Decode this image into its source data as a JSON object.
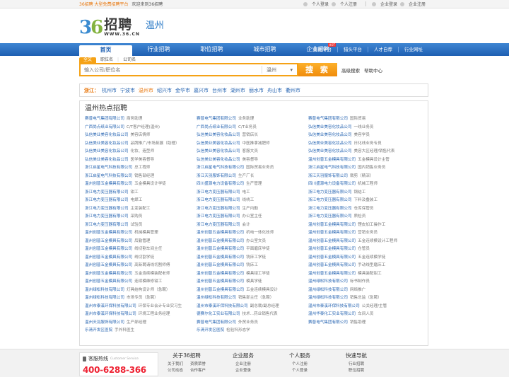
{
  "topbar": {
    "brand": "36招聘 大型免费招聘平台",
    "welcome": "欢迎来到36招聘",
    "person_login": "个人登录",
    "person_register": "个人注册",
    "company_login": "企业登录",
    "company_register": "企业注册"
  },
  "logo": {
    "num_a": "3",
    "num_b": "6",
    "cn": "招聘",
    "url": "WWW.36.CN",
    "city": "温州"
  },
  "nav": {
    "items": [
      "首页",
      "行业招聘",
      "职位招聘",
      "城市招聘",
      "企业招聘"
    ],
    "active": 0,
    "right": [
      "简聘平台",
      "猎头平台",
      "人才自荐",
      "行业网址"
    ],
    "hot_badge": "HOT"
  },
  "search": {
    "tabs": [
      "全文",
      "职位名",
      "公司名"
    ],
    "active_tab": 0,
    "placeholder": "输入公司/职位名",
    "city": "温州",
    "city_arrow": "▾",
    "button": "搜 索",
    "advanced": "高级搜索",
    "help": "帮助中心"
  },
  "cities": {
    "label": "浙江：",
    "items": [
      "杭州市",
      "宁波市",
      "温州市",
      "绍兴市",
      "金华市",
      "嘉兴市",
      "台州市",
      "湖州市",
      "丽水市",
      "舟山市",
      "衢州市"
    ],
    "active": 2
  },
  "hot": {
    "title": "温州热点招聘",
    "rows": [
      [
        [
          "赛普电气集团有限公司",
          "商务助理"
        ],
        [
          "赛普电气集团有限公司",
          "业务助理"
        ],
        [
          "赛普电气集团有限公司",
          "国际贸易"
        ]
      ],
      [
        [
          "广西尚点纸业有限公司",
          "C/T客户经理(温州)"
        ],
        [
          "广西尚点纸业有限公司",
          "C/T业务员"
        ],
        [
          "弘信美业美容化妆品公司",
          "一线业务员"
        ]
      ],
      [
        [
          "弘信美业美容化妆品公司",
          "美容店情师"
        ],
        [
          "弘信美业美容化妆品公司",
          "营销店长"
        ],
        [
          "弘信美业美容化妆品公司",
          "美容学员"
        ]
      ],
      [
        [
          "弘信美业美容化妆品公司",
          "品牌推广/市场拓展（助理）"
        ],
        [
          "弘信美业美容化妆品公司",
          "中医推拿减肥师"
        ],
        [
          "弘信美业美容化妆品公司",
          "日化线业务专员"
        ]
      ],
      [
        [
          "弘信美业美容化妆品公司",
          "化妆、造型师"
        ],
        [
          "弘信美业美容化妆品公司",
          "客服文员"
        ],
        [
          "弘信美业美容化妆品公司",
          "美容大区经理/销售代表"
        ]
      ],
      [
        [
          "弘信美业美容化妆品公司",
          "医学美容督导"
        ],
        [
          "弘信美业美容化妆品公司",
          "美容督导"
        ],
        [
          "温州创普五金模具有限公司",
          "五金模具设计主管"
        ]
      ],
      [
        [
          "浙江启星电气科技有限公司",
          "总工程师"
        ],
        [
          "浙江启星电气科技有限公司",
          "国际贸易业务员"
        ],
        [
          "浙江启星电气科技有限公司",
          "国内销售业务员"
        ]
      ],
      [
        [
          "浙江启星电气科技有限公司",
          "销售部经理"
        ],
        [
          "浙江天羽服饰有限公司",
          "生产厂长"
        ],
        [
          "浙江天羽服饰有限公司",
          "裁剪（精深）"
        ]
      ],
      [
        [
          "温州创普五金模具有限公司",
          "五金模具设计学徒"
        ],
        [
          "四川盛源电力设备有限公司",
          "生产管理"
        ],
        [
          "四川盛源电力设备有限公司",
          "机械工程师"
        ]
      ],
      [
        [
          "浙江电力变压器有限公司",
          "钳工"
        ],
        [
          "浙江电力变压器有限公司",
          "电工"
        ],
        [
          "浙江电力变压器有限公司",
          "钢结工"
        ]
      ],
      [
        [
          "浙江电力变压器有限公司",
          "电焊工"
        ],
        [
          "浙江电力变压器有限公司",
          "线绕工"
        ],
        [
          "浙江电力变压器有限公司",
          "下料及叠装工"
        ]
      ],
      [
        [
          "浙江电力变压器有限公司",
          "主变装配工"
        ],
        [
          "浙江电力变压器有限公司",
          "生产内勤"
        ],
        [
          "浙江电力变压器有限公司",
          "仓库保管员"
        ]
      ],
      [
        [
          "浙江电力变压器有限公司",
          "采购员"
        ],
        [
          "浙江电力变压器有限公司",
          "办公室主任"
        ],
        [
          "浙江电力变压器有限公司",
          "质检员"
        ]
      ],
      [
        [
          "浙江电力变压器有限公司",
          "试验员"
        ],
        [
          "浙江电力变压器有限公司",
          "会计"
        ],
        [
          "温州创普五金模具有限公司",
          "锂皮加工操作工"
        ]
      ],
      [
        [
          "温州创普五金模具有限公司",
          "机械模具管理"
        ],
        [
          "温州创普五金模具有限公司",
          "机电一体化技师"
        ],
        [
          "温州创普五金模具有限公司",
          "营销业务员"
        ]
      ],
      [
        [
          "温州创普五金模具有限公司",
          "后勤管理"
        ],
        [
          "温州创普五金模具有限公司",
          "办公室文员"
        ],
        [
          "温州创普五金模具有限公司",
          "五金连续模设计工程师"
        ]
      ],
      [
        [
          "温州创普五金模具有限公司",
          "线切割车间主任"
        ],
        [
          "温州创普五金模具有限公司",
          "平面磨床学徒"
        ],
        [
          "温州创普五金模具有限公司",
          "仓管员"
        ]
      ],
      [
        [
          "温州创普五金模具有限公司",
          "线切割学徒"
        ],
        [
          "温州创普五金模具有限公司",
          "铣床工学徒"
        ],
        [
          "温州创普五金模具有限公司",
          "五金连续模学徒"
        ]
      ],
      [
        [
          "温州创普五金模具有限公司",
          "高新聘请线切割师傅"
        ],
        [
          "温州创普五金模具有限公司",
          "铣床工"
        ],
        [
          "温州创普五金模具有限公司",
          "手动线型磨床工"
        ]
      ],
      [
        [
          "温州创普五金模具有限公司",
          "五金连续模装配老师"
        ],
        [
          "温州创普五金模具有限公司",
          "模具钳工学徒"
        ],
        [
          "温州创普五金模具有限公司",
          "模具装配钳工"
        ]
      ],
      [
        [
          "温州创普五金模具有限公司",
          "连续模维修钳工"
        ],
        [
          "温州创普五金模具有限公司",
          "模具学徒"
        ],
        [
          "温州绿松科技有限公司",
          "标书制作员"
        ]
      ],
      [
        [
          "温州绿松科技有限公司",
          "灯具结构设计师（急聘）"
        ],
        [
          "温州创普五金模具有限公司",
          "五金连续模具设计"
        ],
        [
          "温州绿松科技有限公司",
          "网络推广"
        ]
      ],
      [
        [
          "温州绿松科技有限公司",
          "市场专员（急聘）"
        ],
        [
          "温州绿松科技有限公司",
          "销售部主任（急聘）"
        ],
        [
          "温州绿松科技有限公司",
          "销售总监（急聘）"
        ]
      ],
      [
        [
          "温州市泰溪环保科技有限公司",
          "环保专业会计专业实习生"
        ],
        [
          "温州市泰溪环保科技有限公司",
          "副总裁/副总经理"
        ],
        [
          "温州市泰溪环保科技有限公司",
          "公关经理/主管"
        ]
      ],
      [
        [
          "温州市泰溪环保科技有限公司",
          "环境工程业务经理"
        ],
        [
          "德赛尔化工实业有限公司",
          "技术...药业销售代表"
        ],
        [
          "温州华泰化工实业有限公司",
          "车间人员"
        ]
      ],
      [
        [
          "温州天羽服饰有限公司",
          "生产部经理"
        ],
        [
          "赛普电气集团有限公司",
          "外贸业务员"
        ],
        [
          "赛普电气集团有限公司",
          "销售助理"
        ]
      ],
      [
        [
          "乐清开发区医院",
          "手外科医生"
        ],
        [
          "乐清开发区医院",
          "检验科形态学"
        ],
        null
      ]
    ]
  },
  "footer": {
    "hotline_label": "客服热线",
    "hotline_en": "Customer Service",
    "hotline_number": "400-6288-366",
    "cols": [
      {
        "title": "关于36招聘",
        "rows": [
          [
            "关于我们",
            "资质荣誉"
          ],
          [
            "公司动态",
            "合作客户"
          ]
        ]
      },
      {
        "title": "企业服务",
        "rows": [
          [
            "企业注册"
          ],
          [
            "企业登录"
          ]
        ]
      },
      {
        "title": "个人服务",
        "rows": [
          [
            "个人注册"
          ],
          [
            "个人登录"
          ]
        ]
      },
      {
        "title": "快速导航",
        "rows": [
          [
            "行业招聘"
          ],
          [
            "职位招聘"
          ]
        ]
      }
    ]
  }
}
